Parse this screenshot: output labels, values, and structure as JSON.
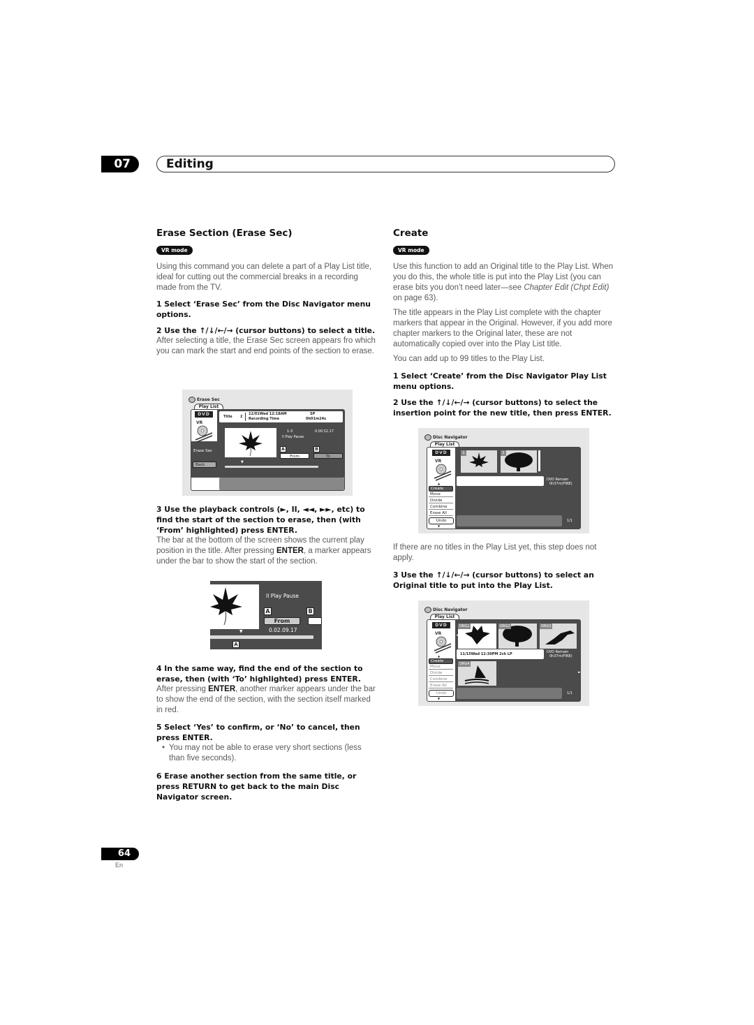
{
  "chapter": {
    "number": "07",
    "title": "Editing"
  },
  "left": {
    "heading": "Erase Section (Erase Sec)",
    "badge": "VR mode",
    "intro": "Using this command you can delete a part of a Play List title, ideal for cutting out the commercial breaks in a recording made from the TV.",
    "step1": "1   Select ‘Erase Sec’ from the Disc Navigator menu options.",
    "step2": "2   Use the ↑/↓/←/→ (cursor buttons) to select a title.",
    "step2_body": "After selecting a title, the Erase Sec screen appears fro which you can mark the start and end points of the section to erase.",
    "step3": "3   Use the playback controls (►, II, ◄◄, ►►, etc) to find the start of the section to erase, then (with ‘From’ highlighted) press ENTER.",
    "step3_body_a": "The bar at the bottom of the screen shows the current play position in the title. After pressing ",
    "step3_body_key": "ENTER",
    "step3_body_b": ", a marker appears under the bar to show the start of the section.",
    "step4": "4   In the same way, find the end of the section to erase, then (with ‘To’ highlighted) press ENTER.",
    "step4_body_a": "After pressing ",
    "step4_body_key": "ENTER",
    "step4_body_b": ", another marker appears under the bar to show the end of the section, with the section itself marked in red.",
    "step5": "5   Select ‘Yes’ to confirm, or ‘No’ to cancel, then press ENTER.",
    "step5_bullet": "You may not be able to erase very short sections (less than five seconds).",
    "step6": "6   Erase another section from the same title, or press RETURN to get back to the main Disc Navigator screen."
  },
  "screen_erase": {
    "title": "Erase Sec",
    "tab": "Play List",
    "dvd": "DVD",
    "vr": "VR",
    "title_label": "Title",
    "title_num": "2",
    "date": "12/01Wed 12:18AM",
    "rec_label": "Recording Time",
    "mode": "SP",
    "rec_time": "0h01m24s",
    "chapter": "1-3",
    "timecode": "0.00.52.17",
    "status": "II Play Pause",
    "side_label": "Erase Sec",
    "marker_a": "A",
    "marker_b": "B",
    "from": "From",
    "to": "To",
    "back": "Back"
  },
  "screen_detail": {
    "status": "II Play Pause",
    "marker_a": "A",
    "marker_b": "B",
    "from": "From",
    "timecode": "0.02.09.17",
    "marker_below": "A"
  },
  "right": {
    "heading": "Create",
    "badge": "VR mode",
    "intro_a": "Use this function to add an Original title to the Play List. When you do this, the whole title is put into the Play List (you can erase bits you don’t need later—see ",
    "intro_ref": "Chapter Edit (Chpt Edit)",
    "intro_b": " on page 63).",
    "para2": "The title appears in the Play List complete with the chapter markers that appear in the Original. However, if you add more chapter markers to the Original later, these are not automatically copied over into the Play List title.",
    "para3": "You can add up to 99 titles to the Play List.",
    "step1": "1   Select ‘Create’ from the Disc Navigator Play List menu options.",
    "step2": "2   Use the ↑/↓/←/→ (cursor buttons) to select the insertion point for the new title, then press ENTER.",
    "step2_note": "If there are no titles in the Play List yet, this step does not apply.",
    "step3": "3   Use the ↑/↓/←/→ (cursor buttons) to select an Original title to put into the Play List."
  },
  "screen_nav1": {
    "title": "Disc Navigator",
    "tab": "Play List",
    "dvd": "DVD",
    "thumbs": [
      "1",
      "2"
    ],
    "remain_label": "DVD Remain",
    "remain_value": "0h37m(FINE)",
    "menu": [
      "Create",
      "Move",
      "Divide",
      "Combine",
      "Erase All"
    ],
    "undo": "Undo",
    "page": "1/1"
  },
  "screen_nav2": {
    "title": "Disc Navigator",
    "tab": "Play List",
    "dvd": "DVD",
    "thumbs": [
      "ORG1",
      "ORG2",
      "ORG3",
      "ORG4"
    ],
    "info": "11/15Wed 12:30PM   2ch LP",
    "remain_label": "DVD Remain",
    "remain_value": "0h37m(FINE)",
    "menu": [
      "Create",
      "Move",
      "Divide",
      "Combine",
      "Erase All"
    ],
    "undo": "Undo",
    "page": "1/1"
  },
  "footer": {
    "page": "64",
    "lang": "En"
  }
}
